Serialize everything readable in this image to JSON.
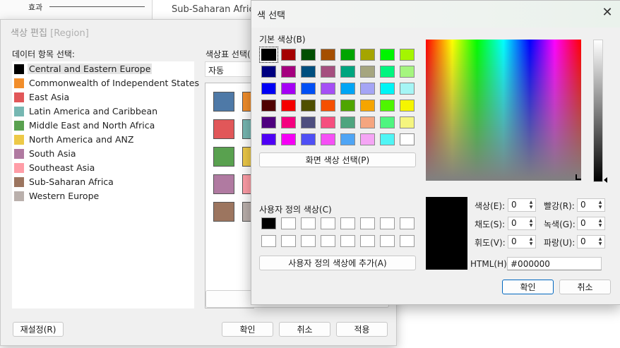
{
  "background": {
    "effect_label": "효과",
    "region_text": "Sub-Saharan Africa"
  },
  "edit_dialog": {
    "title": "색상 편집",
    "title_sub": "[Region]",
    "select_item_label": "데이터 항목 선택:",
    "palette_label": "색상표 선택(S",
    "palette_value": "자동",
    "items": [
      {
        "label": "Central and Eastern Europe",
        "color": "#000000"
      },
      {
        "label": "Commonwealth of Independent States",
        "color": "#f28e2b"
      },
      {
        "label": "East Asia",
        "color": "#e15759"
      },
      {
        "label": "Latin America and Caribbean",
        "color": "#76b7b2"
      },
      {
        "label": "Middle East and North Africa",
        "color": "#59a14f"
      },
      {
        "label": "North America and ANZ",
        "color": "#edc948"
      },
      {
        "label": "South Asia",
        "color": "#b07aa1"
      },
      {
        "label": "Southeast Asia",
        "color": "#ff9da7"
      },
      {
        "label": "Sub-Saharan Africa",
        "color": "#9c755f"
      },
      {
        "label": "Western Europe",
        "color": "#bab0ac"
      }
    ],
    "palette_swatches": [
      "#4e79a7",
      "#f28e2b",
      "#e15759",
      "#76b7b2",
      "#59a14f",
      "#edc948",
      "#b07aa1",
      "#ff9da7",
      "#9c755f",
      "#bab0ac"
    ],
    "reset_button": "재설정(R)",
    "ok_button": "확인",
    "cancel_button": "취소",
    "apply_button": "적용"
  },
  "color_dialog": {
    "title": "색 선택",
    "basic_colors_label": "기본 색상(B)",
    "basic_colors": [
      "#000000",
      "#a50000",
      "#004f00",
      "#a54f00",
      "#00a500",
      "#a5a500",
      "#00f500",
      "#a5f500",
      "#000080",
      "#a5007f",
      "#004f7f",
      "#a54f7f",
      "#00a57f",
      "#a5a57f",
      "#00f57f",
      "#a5f57f",
      "#0000f5",
      "#a500f5",
      "#004ff5",
      "#a54ff5",
      "#00a5f5",
      "#a5a5f5",
      "#00f5f5",
      "#a5f5f5",
      "#4f0000",
      "#f50000",
      "#4f4f00",
      "#f54f00",
      "#4fa500",
      "#f5a500",
      "#4ff500",
      "#f5f500",
      "#4f007f",
      "#f5007f",
      "#4f4f7f",
      "#f54f7f",
      "#4fa57f",
      "#f5a57f",
      "#4ff57f",
      "#f5f57f",
      "#4f00f5",
      "#f500f5",
      "#4f4ff5",
      "#f54ff5",
      "#4fa5f5",
      "#f5a5f5",
      "#4ff5f5",
      "#ffffff"
    ],
    "pick_screen_button": "화면 색상 선택(P)",
    "custom_colors_label": "사용자 정의 색상(C)",
    "add_custom_button": "사용자 정의 색상에 추가(A)",
    "hue_label": "색상(E):",
    "hue": "0",
    "sat_label": "채도(S):",
    "sat": "0",
    "lum_label": "휘도(V):",
    "lum": "0",
    "red_label": "빨강(R):",
    "red": "0",
    "green_label": "녹색(G):",
    "green": "0",
    "blue_label": "파랑(U):",
    "blue": "0",
    "html_label": "HTML(H):",
    "html_value": "#000000",
    "ok_button": "확인",
    "cancel_button": "취소"
  }
}
